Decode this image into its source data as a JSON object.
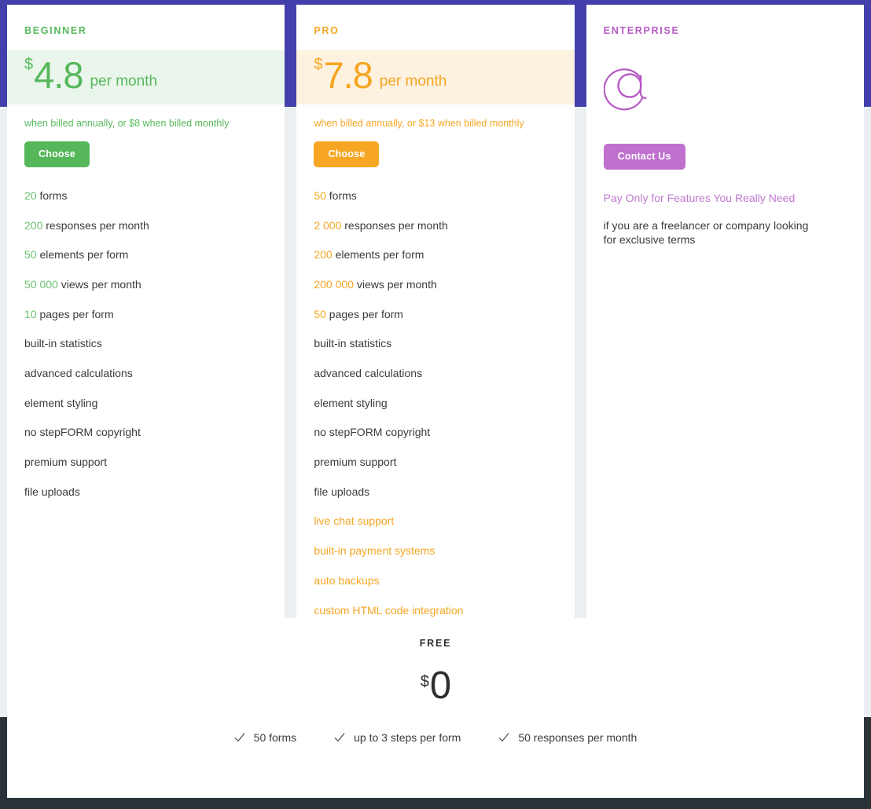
{
  "theme": {
    "band_top_color": "#4340ab",
    "band_bottom_color": "#2b3338",
    "page_bg": "#eceff1",
    "green": "#57b85b",
    "orange": "#f6a623",
    "purple": "#b659c4"
  },
  "plans": [
    {
      "name": "BEGINNER",
      "currency": "$",
      "amount": "4.8",
      "per": "per month",
      "billing_note": "when billed annually, or $8 when billed monthly",
      "cta": "Choose",
      "features": [
        {
          "value": "20",
          "text": "forms"
        },
        {
          "value": "200",
          "text": "responses per month"
        },
        {
          "value": "50",
          "text": "elements per form"
        },
        {
          "value": "50 000",
          "text": "views per month"
        },
        {
          "value": "10",
          "text": "pages per form"
        },
        {
          "value": "",
          "text": "built-in statistics"
        },
        {
          "value": "",
          "text": "advanced calculations"
        },
        {
          "value": "",
          "text": "element styling"
        },
        {
          "value": "",
          "text": "no stepFORM copyright"
        },
        {
          "value": "",
          "text": "premium support"
        },
        {
          "value": "",
          "text": "file uploads"
        }
      ]
    },
    {
      "name": "PRO",
      "currency": "$",
      "amount": "7.8",
      "per": "per month",
      "billing_note": "when billed annually, or $13 when billed monthly",
      "cta": "Choose",
      "features": [
        {
          "value": "50",
          "text": "forms"
        },
        {
          "value": "2 000",
          "text": "responses per month"
        },
        {
          "value": "200",
          "text": "elements per form"
        },
        {
          "value": "200 000",
          "text": "views per month"
        },
        {
          "value": "50",
          "text": "pages per form"
        },
        {
          "value": "",
          "text": "built-in statistics"
        },
        {
          "value": "",
          "text": "advanced calculations"
        },
        {
          "value": "",
          "text": "element styling"
        },
        {
          "value": "",
          "text": "no stepFORM copyright"
        },
        {
          "value": "",
          "text": "premium support"
        },
        {
          "value": "",
          "text": "file uploads"
        }
      ],
      "exclusive_features": [
        "live chat support",
        "built-in payment systems",
        "auto backups",
        "custom HTML code integration"
      ]
    },
    {
      "name": "ENTERPRISE",
      "icon": "at-sign-icon",
      "cta": "Contact Us",
      "tagline": "Pay Only for Features You Really Need",
      "description": "if you are a freelancer or company looking for exclusive terms"
    }
  ],
  "free": {
    "title": "FREE",
    "currency": "$",
    "amount": "0",
    "features": [
      "50 forms",
      "up to 3 steps per form",
      "50 responses per month"
    ]
  }
}
